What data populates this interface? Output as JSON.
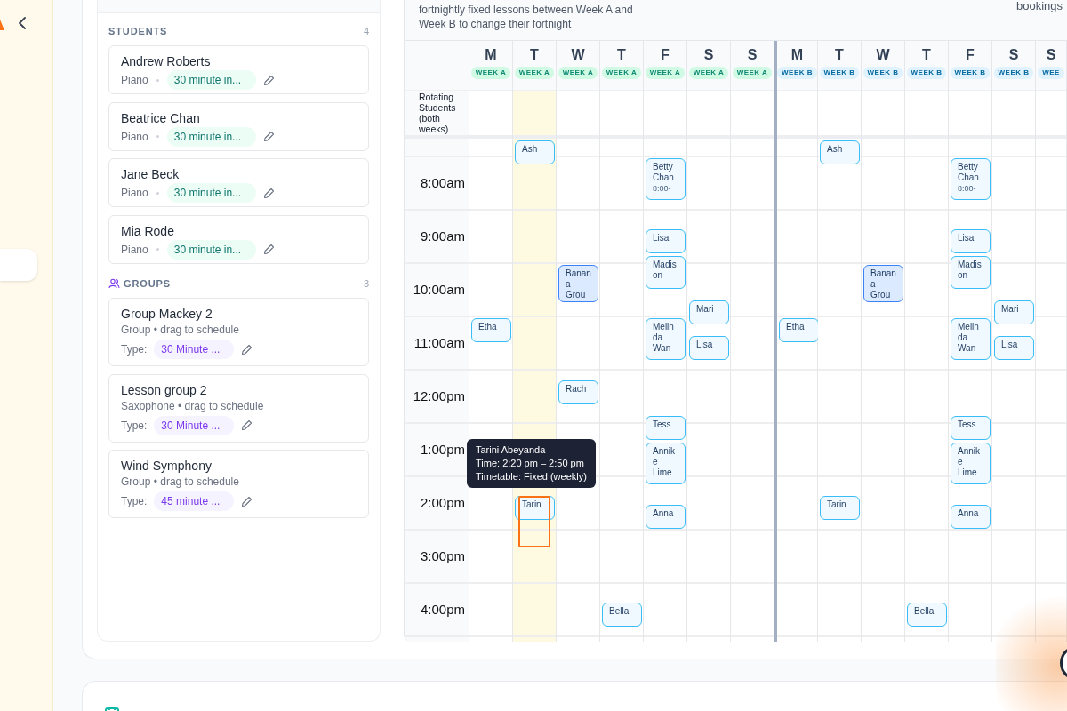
{
  "students": {
    "title": "STUDENTS",
    "count": "4",
    "items": [
      {
        "name": "Andrew Roberts",
        "instrument": "Piano",
        "lesson_type": "30 minute in..."
      },
      {
        "name": "Beatrice Chan",
        "instrument": "Piano",
        "lesson_type": "30 minute in..."
      },
      {
        "name": "Jane Beck",
        "instrument": "Piano",
        "lesson_type": "30 minute in..."
      },
      {
        "name": "Mia Rode",
        "instrument": "Piano",
        "lesson_type": "30 minute in..."
      }
    ]
  },
  "groups": {
    "title": "GROUPS",
    "count": "3",
    "items": [
      {
        "name": "Group Mackey 2",
        "subtitle": "Group • drag to schedule",
        "type_label": "Type:",
        "lesson_type": "30 Minute ..."
      },
      {
        "name": "Lesson group 2",
        "subtitle": "Saxophone • drag to schedule",
        "type_label": "Type:",
        "lesson_type": "30 Minute ..."
      },
      {
        "name": "Wind Symphony",
        "subtitle": "Group • drag to schedule",
        "type_label": "Type:",
        "lesson_type": "45 minute ..."
      }
    ]
  },
  "calendar": {
    "description": [
      "fortnightly fixed lessons between Week A and",
      "Week B to change their fortnight"
    ],
    "bookings_text": "bookings",
    "rotating_label": "Rotating Students (both weeks)",
    "times": [
      "8:00am",
      "9:00am",
      "10:00am",
      "11:00am",
      "12:00pm",
      "1:00pm",
      "2:00pm",
      "3:00pm",
      "4:00pm"
    ],
    "days": [
      {
        "letter": "M",
        "week_label": "WEEK A",
        "kind": "a",
        "highlighted": false,
        "events": [
          {
            "name": "Etha",
            "kind": "lesson"
          }
        ]
      },
      {
        "letter": "T",
        "week_label": "WEEK A",
        "kind": "a",
        "highlighted": true,
        "events": [
          {
            "name": "Ash",
            "kind": "lesson"
          },
          {
            "name": "Tarin",
            "kind": "lesson",
            "drag_preview": true,
            "tooltip": [
              "Tarini Abeyanda",
              "Time: 2:20 pm – 2:50 pm",
              "Timetable: Fixed (weekly)"
            ]
          }
        ]
      },
      {
        "letter": "W",
        "week_label": "WEEK A",
        "kind": "a",
        "highlighted": false,
        "events": [
          {
            "name": "Banana Grou",
            "kind": "group"
          },
          {
            "name": "Rach",
            "kind": "lesson"
          }
        ]
      },
      {
        "letter": "T",
        "week_label": "WEEK A",
        "kind": "a",
        "highlighted": false,
        "events": [
          {
            "name": "Bella",
            "kind": "lesson"
          }
        ]
      },
      {
        "letter": "F",
        "week_label": "WEEK A",
        "kind": "a",
        "highlighted": false,
        "events": [
          {
            "name": "Betty Chan",
            "time": "8:00-",
            "kind": "lesson"
          },
          {
            "name": "Lisa",
            "kind": "lesson"
          },
          {
            "name": "Madison",
            "kind": "lesson"
          },
          {
            "name": "Melinda Wan",
            "kind": "lesson"
          },
          {
            "name": "Tess",
            "kind": "lesson"
          },
          {
            "name": "Annike Lime",
            "kind": "lesson"
          },
          {
            "name": "Anna",
            "kind": "lesson"
          }
        ]
      },
      {
        "letter": "S",
        "week_label": "WEEK A",
        "kind": "a",
        "highlighted": false,
        "events": [
          {
            "name": "Mari",
            "kind": "lesson"
          },
          {
            "name": "Lisa",
            "kind": "lesson"
          }
        ]
      },
      {
        "letter": "S",
        "week_label": "WEEK A",
        "kind": "a",
        "highlighted": false
      },
      {
        "letter": "M",
        "week_label": "WEEK B",
        "kind": "b",
        "highlighted": false,
        "events": [
          {
            "name": "Etha",
            "kind": "lesson"
          }
        ]
      },
      {
        "letter": "T",
        "week_label": "WEEK B",
        "kind": "b",
        "highlighted": false,
        "events": [
          {
            "name": "Ash",
            "kind": "lesson"
          },
          {
            "name": "Tarin",
            "kind": "lesson"
          }
        ]
      },
      {
        "letter": "W",
        "week_label": "WEEK B",
        "kind": "b",
        "highlighted": false,
        "events": [
          {
            "name": "Banana Grou",
            "kind": "group"
          }
        ]
      },
      {
        "letter": "T",
        "week_label": "WEEK B",
        "kind": "b",
        "highlighted": false,
        "events": [
          {
            "name": "Bella",
            "kind": "lesson"
          }
        ]
      },
      {
        "letter": "F",
        "week_label": "WEEK B",
        "kind": "b",
        "highlighted": false,
        "events": [
          {
            "name": "Betty Chan",
            "time": "8:00-",
            "kind": "lesson"
          },
          {
            "name": "Lisa",
            "kind": "lesson"
          },
          {
            "name": "Madison",
            "kind": "lesson"
          },
          {
            "name": "Melinda Wan",
            "kind": "lesson"
          },
          {
            "name": "Tess",
            "kind": "lesson"
          },
          {
            "name": "Annike Lime",
            "kind": "lesson"
          },
          {
            "name": "Anna",
            "kind": "lesson"
          }
        ]
      },
      {
        "letter": "S",
        "week_label": "WEEK B",
        "kind": "b",
        "highlighted": false,
        "events": [
          {
            "name": "Mari",
            "kind": "lesson"
          },
          {
            "name": "Lisa",
            "kind": "lesson"
          }
        ]
      },
      {
        "letter": "S",
        "week_label": "WEE",
        "kind": "b",
        "highlighted": false
      }
    ]
  }
}
